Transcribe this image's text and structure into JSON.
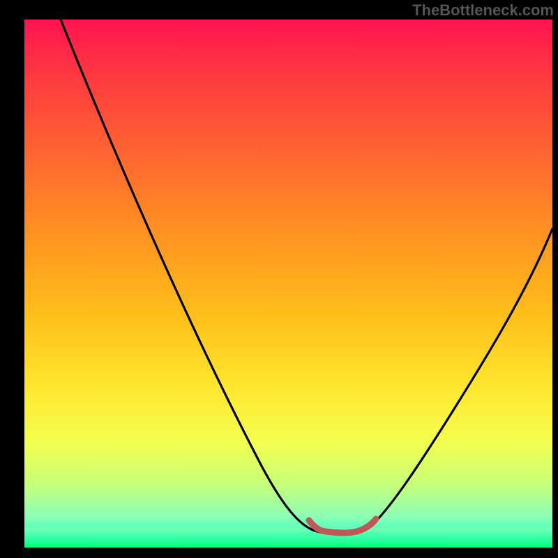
{
  "watermark": "TheBottleneck.com",
  "chart_data": {
    "type": "line",
    "title": "",
    "xlabel": "",
    "ylabel": "",
    "xlim": [
      0,
      100
    ],
    "ylim": [
      0,
      100
    ],
    "series": [
      {
        "name": "bottleneck-curve",
        "x": [
          0,
          6,
          12,
          18,
          24,
          30,
          36,
          42,
          48,
          54,
          56,
          58,
          60,
          62,
          64,
          66,
          70,
          76,
          82,
          88,
          94,
          100
        ],
        "values": [
          100,
          90,
          80,
          70,
          60,
          50,
          40,
          30,
          20,
          10,
          5,
          3,
          1,
          1,
          1,
          2,
          6,
          15,
          26,
          37,
          48,
          60
        ],
        "color": "#000000"
      },
      {
        "name": "optimal-zone-marker",
        "x": [
          55,
          58,
          60,
          62,
          65,
          67
        ],
        "values": [
          4,
          2,
          1.5,
          1.5,
          2,
          4
        ],
        "color": "#c84b4b"
      }
    ],
    "annotations": [],
    "notes": "Background is a vertical rainbow gradient (red→green). Values are estimated from pixel position; no axis ticks or labels are shown."
  }
}
